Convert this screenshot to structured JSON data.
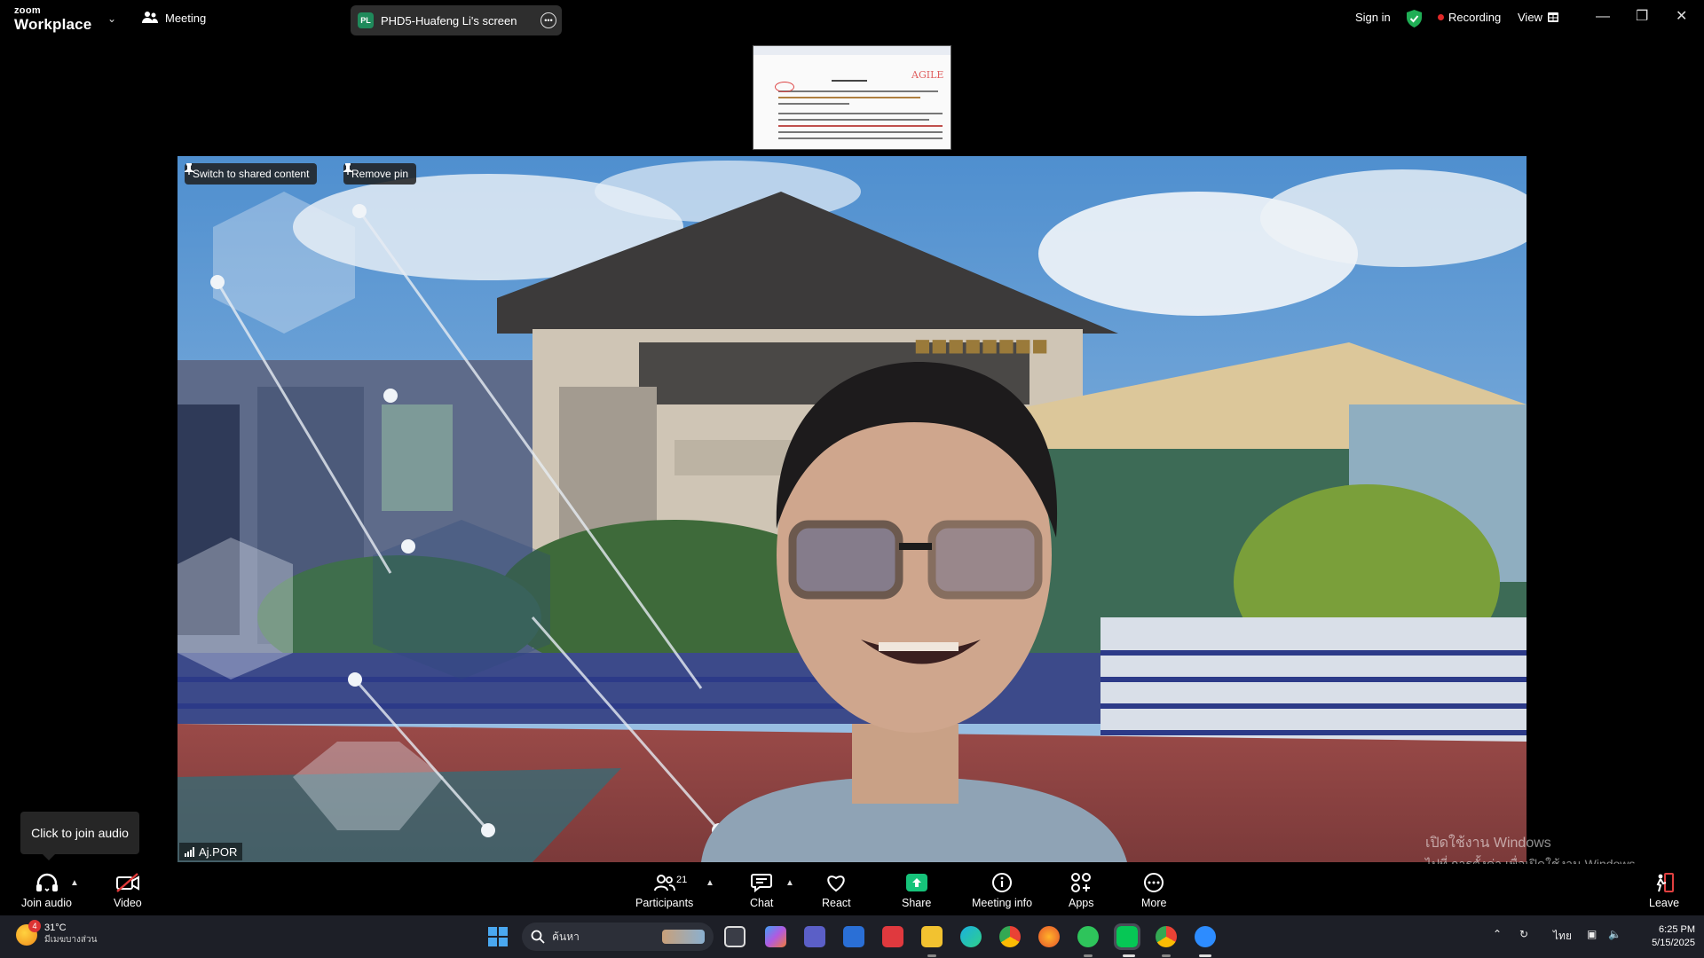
{
  "titlebar": {
    "logo_small": "zoom",
    "logo_big": "Workplace",
    "meeting_label": "Meeting",
    "screen_tab_initials": "PL",
    "screen_tab_title": "PHD5-Huafeng Li's screen",
    "sign_in": "Sign in",
    "recording": "Recording",
    "view": "View"
  },
  "shared_thumb": {
    "corner_mark": "AGILE"
  },
  "video": {
    "switch_label": "Switch to shared content",
    "remove_pin_label": "Remove pin",
    "participant_name": "Aj.POR"
  },
  "tooltip": "Click to join audio",
  "watermark": {
    "line1": "เปิดใช้งาน Windows",
    "line2": "ไปที่ การตั้งค่า เพื่อเปิดใช้งาน Windows"
  },
  "toolbar": {
    "join_audio": "Join audio",
    "video": "Video",
    "participants": "Participants",
    "participants_count": "21",
    "chat": "Chat",
    "react": "React",
    "share": "Share",
    "meeting_info": "Meeting info",
    "apps": "Apps",
    "more": "More",
    "leave": "Leave"
  },
  "taskbar": {
    "weather_badge": "4",
    "temperature": "31°C",
    "weather_desc": "มีเมฆบางส่วน",
    "search_placeholder": "ค้นหา",
    "language": "ไทย",
    "time": "6:25 PM",
    "date": "5/15/2025"
  },
  "colors": {
    "accent_green": "#16c37a",
    "record_red": "#e02828",
    "shield_green": "#1fae55"
  }
}
